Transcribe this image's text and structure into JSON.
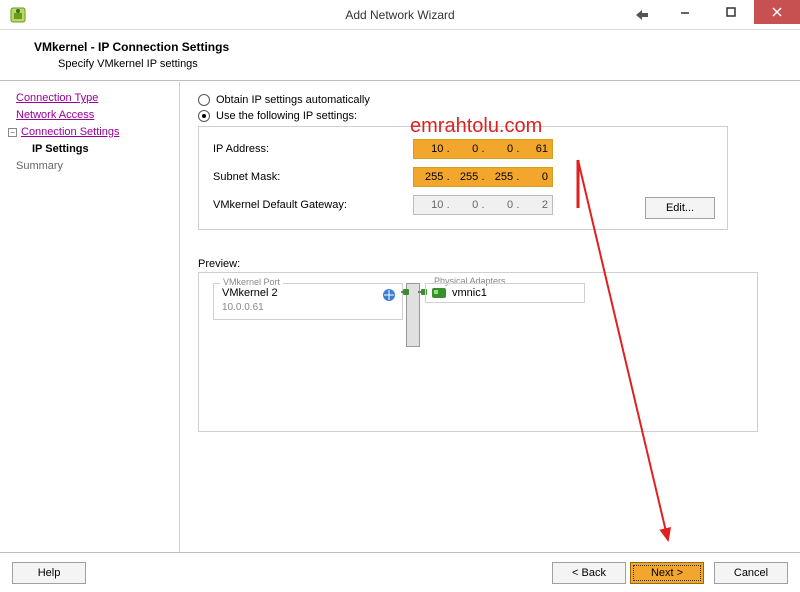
{
  "window": {
    "title": "Add Network Wizard",
    "icon_name": "vsphere-icon"
  },
  "header": {
    "title": "VMkernel - IP Connection Settings",
    "subtitle": "Specify VMkernel IP settings"
  },
  "sidebar": {
    "steps": {
      "connection_type": "Connection Type",
      "network_access": "Network Access",
      "connection_settings": "Connection Settings",
      "ip_settings": "IP Settings",
      "summary": "Summary"
    }
  },
  "ip_options": {
    "auto_label": "Obtain IP settings automatically",
    "manual_label": "Use the following IP settings:",
    "selected": "manual"
  },
  "ip_fields": {
    "ip_address_label": "IP Address:",
    "ip_address": {
      "o1": "10",
      "o2": "0",
      "o3": "0",
      "o4": "61"
    },
    "subnet_label": "Subnet Mask:",
    "subnet": {
      "o1": "255",
      "o2": "255",
      "o3": "255",
      "o4": "0"
    },
    "gateway_label": "VMkernel Default Gateway:",
    "gateway": {
      "o1": "10",
      "o2": "0",
      "o3": "0",
      "o4": "2"
    },
    "edit_label": "Edit..."
  },
  "preview": {
    "label": "Preview:",
    "vmk_group_label": "VMkernel Port",
    "vmk_name": "VMkernel 2",
    "vmk_ip": "10.0.0.61",
    "phys_group_label": "Physical Adapters",
    "phys_name": "vmnic1"
  },
  "footer": {
    "help": "Help",
    "back": "< Back",
    "next": "Next >",
    "cancel": "Cancel"
  },
  "watermark": "emrahtolu.com",
  "colors": {
    "highlight": "#f2a72c",
    "annotation": "#e02020"
  }
}
